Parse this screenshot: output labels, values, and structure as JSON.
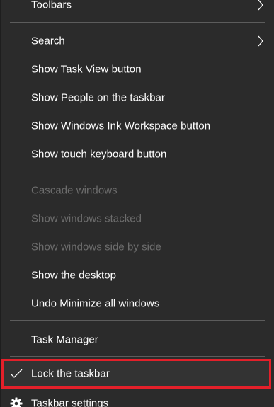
{
  "context_menu": {
    "toolbars_label": "Toolbars",
    "search_label": "Search",
    "show_task_view_label": "Show Task View button",
    "show_people_label": "Show People on the taskbar",
    "show_ink_workspace_label": "Show Windows Ink Workspace button",
    "show_touch_keyboard_label": "Show touch keyboard button",
    "cascade_windows_label": "Cascade windows",
    "show_windows_stacked_label": "Show windows stacked",
    "show_windows_side_by_side_label": "Show windows side by side",
    "show_desktop_label": "Show the desktop",
    "undo_minimize_label": "Undo Minimize all windows",
    "task_manager_label": "Task Manager",
    "lock_taskbar_label": "Lock the taskbar",
    "lock_taskbar_checked": true,
    "taskbar_settings_label": "Taskbar settings"
  },
  "icons": {
    "submenu": "chevron-right-icon",
    "checked": "checkmark-icon",
    "settings": "gear-icon"
  },
  "colors": {
    "menu_background": "#2b2b2b",
    "text": "#ffffff",
    "disabled_text": "#6d6d6d",
    "separator": "#5c5c5c",
    "highlight_border": "#e3202a"
  }
}
